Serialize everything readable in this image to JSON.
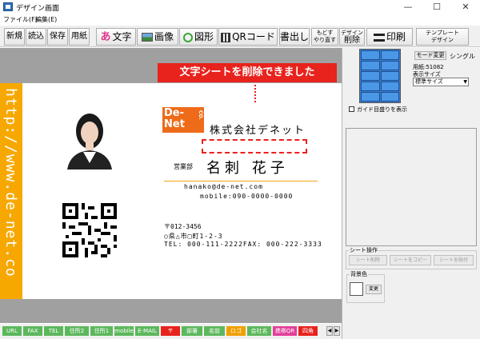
{
  "window": {
    "title": "デザイン画面",
    "minimize_glyph": "—",
    "maximize_glyph": "☐",
    "close_glyph": "✕"
  },
  "menu": {
    "file": "ファイル(F)",
    "edit": "編集(E)"
  },
  "toolbar": {
    "new": "新規",
    "open": "読込",
    "save": "保存",
    "paper": "用紙",
    "text_icon": "あ",
    "text": "文字",
    "image": "画像",
    "shape": "図形",
    "qr": "QRコード",
    "export": "書出し",
    "undo_line1": "もどす",
    "undo_line2": "やり直す",
    "delete_line1": "デザイン",
    "delete_line2": "削除",
    "print": "印刷",
    "template_line1": "テンプレート",
    "template_line2": "デザイン"
  },
  "card": {
    "vertical_url": "http://www.de-net.co",
    "logo_line1": "De-",
    "logo_line2": "Net",
    "logo_sub": "CO.",
    "company": "株式会社デネット",
    "department": "営業部",
    "name": "名刺 花子",
    "email": "hanako@de-net.com",
    "mobile": "mobile:090-0000-0000",
    "zip": "〒012-3456",
    "address": "○県△市□町1-2-3",
    "tel_fax": "TEL: 000-111-2222FAX: 000-222-3333"
  },
  "notice": {
    "message": "文字シートを削除できました"
  },
  "tags": [
    {
      "label": "URL",
      "color": "#5cb85c"
    },
    {
      "label": "FAX",
      "color": "#5cb85c"
    },
    {
      "label": "TEL",
      "color": "#5cb85c"
    },
    {
      "label": "住所2",
      "color": "#5cb85c"
    },
    {
      "label": "住所1",
      "color": "#5cb85c"
    },
    {
      "label": "mobile",
      "color": "#5cb85c"
    },
    {
      "label": "E-MAIL",
      "color": "#5cb85c"
    },
    {
      "label": "〒",
      "color": "#e8221c"
    },
    {
      "label": "部署",
      "color": "#5cb85c"
    },
    {
      "label": "名前",
      "color": "#5cb85c"
    },
    {
      "label": "ロゴ",
      "color": "#f0a000"
    },
    {
      "label": "会社名",
      "color": "#5cb85c"
    },
    {
      "label": "携帯QR",
      "color": "#e23f9a"
    },
    {
      "label": "四角",
      "color": "#e8221c"
    }
  ],
  "tag_scroll": {
    "left": "◀",
    "right": "▶"
  },
  "panel": {
    "mode_button": "モード変更",
    "mode_value": "シングル",
    "paper_label": "用紙:51082",
    "display_size_label": "表示サイズ",
    "display_size_value": "標準サイズ",
    "guide_checkbox_label": "ガイド目盛りを表示",
    "guide_checked": false,
    "sheet_ops_label": "シート操作",
    "sheet_delete": "シート削除",
    "sheet_copy": "シートをコピー",
    "sheet_paste": "シートを貼付",
    "bg_color_label": "背景色",
    "bg_color_value": "#ffffff",
    "bg_change": "変更"
  },
  "colors": {
    "accent_orange": "#f6a800",
    "alert_red": "#e8221c",
    "logo_orange": "#ee6b1a"
  }
}
